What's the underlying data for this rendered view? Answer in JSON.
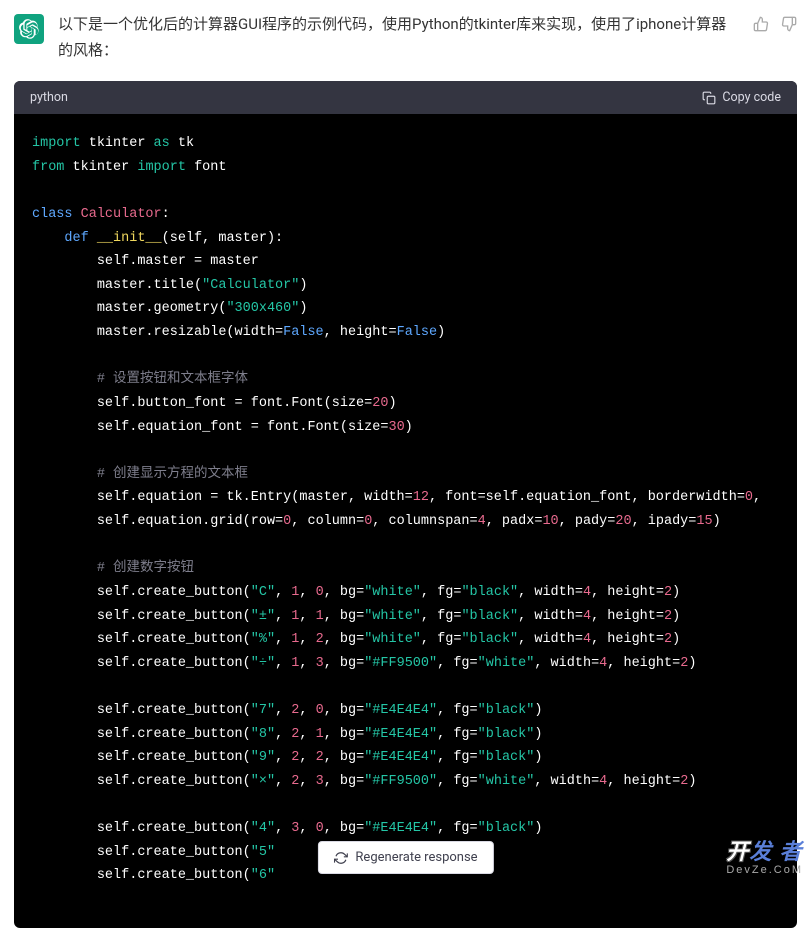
{
  "intro": "以下是一个优化后的计算器GUI程序的示例代码，使用Python的tkinter库来实现，使用了iphone计算器的风格：",
  "codeHeader": {
    "lang": "python",
    "copy": "Copy code"
  },
  "regen": "Regenerate response",
  "watermark": {
    "left": "开",
    "right": "发 者",
    "sub": "DevZe.CoM"
  },
  "code": {
    "l1_import": "import",
    "l1_tkinter": "tkinter",
    "l1_as": "as",
    "l1_tk": "tk",
    "l2_from": "from",
    "l2_tkinter": "tkinter",
    "l2_import": "import",
    "l2_font": "font",
    "l4_class": "class",
    "l4_name": "Calculator",
    "l5_def": "def",
    "l5_init": "__init__",
    "l5_args": "(self, master):",
    "l6": "self.master = master",
    "l7a": "master.title(",
    "l7s": "\"Calculator\"",
    "l7b": ")",
    "l8a": "master.geometry(",
    "l8s": "\"300x460\"",
    "l8b": ")",
    "l9a": "master.resizable(width=",
    "l9f1": "False",
    "l9b": ", height=",
    "l9f2": "False",
    "l9c": ")",
    "c1": "# 设置按钮和文本框字体",
    "l11a": "self.button_font = font.Font(size=",
    "l11n": "20",
    "l11b": ")",
    "l12a": "self.equation_font = font.Font(size=",
    "l12n": "30",
    "l12b": ")",
    "c2": "# 创建显示方程的文本框",
    "l14a": "self.equation = tk.Entry(master, width=",
    "l14n1": "12",
    "l14b": ", font=self.equation_font, borderwidth=",
    "l14n2": "0",
    "l14c": ", ",
    "l15a": "self.equation.grid(row=",
    "l15n1": "0",
    "l15b": ", column=",
    "l15n2": "0",
    "l15c": ", columnspan=",
    "l15n3": "4",
    "l15d": ", padx=",
    "l15n4": "10",
    "l15e": ", pady=",
    "l15n5": "20",
    "l15f": ", ipady=",
    "l15n6": "15",
    "l15g": ")",
    "c3": "# 创建数字按钮",
    "l17a": "self.create_button(",
    "l17s": "\"C\"",
    "l17b": ", ",
    "l17n1": "1",
    "l17c": ", ",
    "l17n2": "0",
    "l17d": ", bg=",
    "l17s2": "\"white\"",
    "l17e": ", fg=",
    "l17s3": "\"black\"",
    "l17f": ", width=",
    "l17n3": "4",
    "l17g": ", height=",
    "l17n4": "2",
    "l17h": ")",
    "l18s": "\"±\"",
    "l18n1": "1",
    "l18n2": "1",
    "l19s": "\"%\"",
    "l19n1": "1",
    "l19n2": "2",
    "l20s": "\"÷\"",
    "l20n1": "1",
    "l20n2": "3",
    "l20bg": "\"#FF9500\"",
    "l20fg": "\"white\"",
    "l22s": "\"7\"",
    "l22n1": "2",
    "l22n2": "0",
    "l22bg": "\"#E4E4E4\"",
    "l22fg": "\"black\"",
    "l23s": "\"8\"",
    "l23n1": "2",
    "l23n2": "1",
    "l24s": "\"9\"",
    "l24n1": "2",
    "l24n2": "2",
    "l25s": "\"×\"",
    "l25n1": "2",
    "l25n2": "3",
    "l27s": "\"4\"",
    "l27n1": "3",
    "l27n2": "0",
    "l28s": "\"5\"",
    "l29s": "\"6\""
  }
}
